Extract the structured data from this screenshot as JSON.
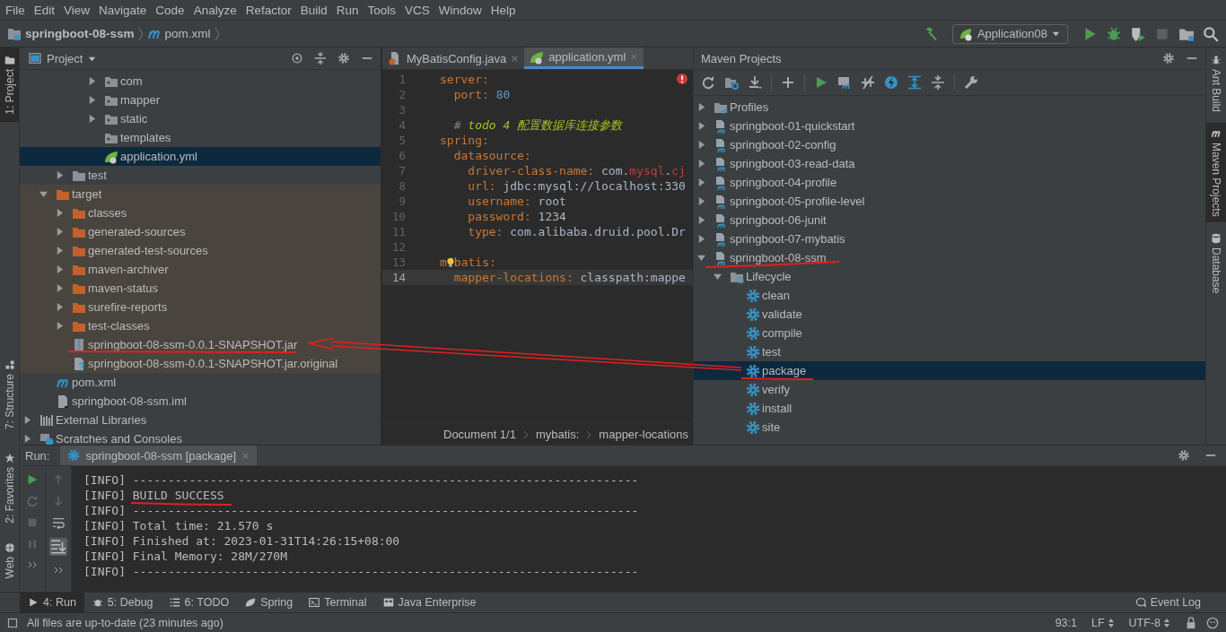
{
  "menu": [
    "File",
    "Edit",
    "View",
    "Navigate",
    "Code",
    "Analyze",
    "Refactor",
    "Build",
    "Run",
    "Tools",
    "VCS",
    "Window",
    "Help"
  ],
  "breadcrumb": [
    {
      "label": "springboot-08-ssm",
      "kind": "project"
    },
    {
      "label": "pom.xml",
      "kind": "maven"
    }
  ],
  "run_config": "Application08",
  "left_tool_tabs": [
    {
      "label": "1: Project",
      "selected": true,
      "kind": "folder"
    },
    {
      "label": "7: Structure",
      "selected": false,
      "kind": "structure"
    }
  ],
  "project_panel": {
    "title": "Project",
    "tree": [
      {
        "children": [
          {
            "children": [
              {
                "children": [
                  {
                    "children": [
                      {
                        "label": "com",
                        "kind": "package-folder",
                        "expanded": false,
                        "selected": false
                      },
                      {
                        "label": "mapper",
                        "kind": "package-folder",
                        "expanded": false,
                        "selected": false
                      },
                      {
                        "label": "static",
                        "kind": "package-folder",
                        "expanded": false,
                        "selected": false
                      },
                      {
                        "label": "templates",
                        "kind": "package-folder",
                        "selected": false
                      },
                      {
                        "label": "application.yml",
                        "kind": "yml",
                        "selected": true
                      }
                    ]
                  }
                ]
              },
              {
                "label": "test",
                "kind": "folder",
                "expanded": false,
                "selected": false
              }
            ]
          },
          {
            "label": "target",
            "kind": "excluded-folder",
            "expanded": true,
            "excluded": true,
            "selected": false,
            "children": [
              {
                "label": "classes",
                "kind": "excluded-folder",
                "expanded": false,
                "selected": false
              },
              {
                "label": "generated-sources",
                "kind": "excluded-folder",
                "expanded": false,
                "selected": false
              },
              {
                "label": "generated-test-sources",
                "kind": "excluded-folder",
                "expanded": false,
                "selected": false
              },
              {
                "label": "maven-archiver",
                "kind": "excluded-folder",
                "expanded": false,
                "selected": false
              },
              {
                "label": "maven-status",
                "kind": "excluded-folder",
                "expanded": false,
                "selected": false
              },
              {
                "label": "surefire-reports",
                "kind": "excluded-folder",
                "expanded": false,
                "selected": false
              },
              {
                "label": "test-classes",
                "kind": "excluded-folder",
                "expanded": false,
                "selected": false
              },
              {
                "label": "springboot-08-ssm-0.0.1-SNAPSHOT.jar",
                "kind": "jar",
                "selected": false
              },
              {
                "label": "springboot-08-ssm-0.0.1-SNAPSHOT.jar.original",
                "kind": "unknown-file",
                "selected": false
              }
            ]
          },
          {
            "label": "pom.xml",
            "kind": "maven",
            "selected": false
          },
          {
            "label": "springboot-08-ssm.iml",
            "kind": "iml",
            "selected": false
          }
        ]
      },
      {
        "label": "External Libraries",
        "kind": "libraries",
        "expanded": false,
        "selected": false
      },
      {
        "label": "Scratches and Consoles",
        "kind": "scratches",
        "expanded": false,
        "selected": false
      }
    ]
  },
  "editor": {
    "tabs": [
      {
        "label": "MyBatisConfig.java",
        "kind": "java",
        "selected": false
      },
      {
        "label": "application.yml",
        "kind": "yml",
        "selected": true
      }
    ],
    "lines": [
      {
        "number": "1",
        "current": false,
        "tokens": [
          {
            "text": "server:",
            "kind": "key"
          }
        ]
      },
      {
        "number": "2",
        "current": false,
        "tokens": [
          {
            "text": "  port: ",
            "kind": "key"
          },
          {
            "text": "80",
            "kind": "number"
          }
        ]
      },
      {
        "number": "3",
        "current": false
      },
      {
        "number": "4",
        "current": false,
        "tokens": [
          {
            "text": "  # ",
            "kind": "comment"
          },
          {
            "text": "todo 4 配置数据库连接参数",
            "kind": "todo"
          }
        ]
      },
      {
        "number": "5",
        "current": false,
        "tokens": [
          {
            "text": "spring:",
            "kind": "key"
          }
        ]
      },
      {
        "number": "6",
        "current": false,
        "tokens": [
          {
            "text": "  datasource:",
            "kind": "key"
          }
        ]
      },
      {
        "number": "7",
        "current": false,
        "tokens": [
          {
            "text": "    driver-class-name: ",
            "kind": "key"
          },
          {
            "text": "com.",
            "kind": "scalar"
          },
          {
            "text": "mysql",
            "kind": "error"
          },
          {
            "text": ".",
            "kind": "scalar"
          },
          {
            "text": "cj",
            "kind": "error"
          }
        ]
      },
      {
        "number": "8",
        "current": false,
        "tokens": [
          {
            "text": "    url: ",
            "kind": "key"
          },
          {
            "text": "jdbc:mysql://localhost:330",
            "kind": "scalar"
          }
        ]
      },
      {
        "number": "9",
        "current": false,
        "tokens": [
          {
            "text": "    username: ",
            "kind": "key"
          },
          {
            "text": "root",
            "kind": "scalar"
          }
        ]
      },
      {
        "number": "10",
        "current": false,
        "tokens": [
          {
            "text": "    password: ",
            "kind": "key"
          },
          {
            "text": "1234",
            "kind": "scalar"
          }
        ]
      },
      {
        "number": "11",
        "current": false,
        "tokens": [
          {
            "text": "    type: ",
            "kind": "key"
          },
          {
            "text": "com.alibaba.druid.pool.Dr",
            "kind": "scalar"
          }
        ]
      },
      {
        "number": "12",
        "current": false
      },
      {
        "number": "13",
        "current": false,
        "tokens": [
          {
            "text": "m",
            "kind": "key"
          },
          {
            "kind": "bulb"
          },
          {
            "text": "batis:",
            "kind": "key"
          }
        ]
      },
      {
        "number": "14",
        "current": true,
        "tokens": [
          {
            "text": "  mapper-locations: ",
            "kind": "key"
          },
          {
            "text": "classpath:mappe",
            "kind": "scalar"
          }
        ]
      }
    ],
    "breadcrumb": [
      "Document 1/1",
      "mybatis:",
      "mapper-locations"
    ]
  },
  "maven_panel": {
    "title": "Maven Projects",
    "tree": [
      {
        "label": "Profiles",
        "kind": "profiles",
        "expanded": false,
        "selected": false
      },
      {
        "label": "springboot-01-quickstart",
        "kind": "module",
        "expanded": false,
        "selected": false
      },
      {
        "label": "springboot-02-config",
        "kind": "module",
        "expanded": false,
        "selected": false
      },
      {
        "label": "springboot-03-read-data",
        "kind": "module",
        "expanded": false,
        "selected": false
      },
      {
        "label": "springboot-04-profile",
        "kind": "module",
        "expanded": false,
        "selected": false
      },
      {
        "label": "springboot-05-profile-level",
        "kind": "module",
        "expanded": false,
        "selected": false
      },
      {
        "label": "springboot-06-junit",
        "kind": "module",
        "expanded": false,
        "selected": false
      },
      {
        "label": "springboot-07-mybatis",
        "kind": "module",
        "expanded": false,
        "selected": false
      },
      {
        "label": "springboot-08-ssm",
        "kind": "module",
        "expanded": true,
        "selected": false,
        "children": [
          {
            "label": "Lifecycle",
            "kind": "lifecycle",
            "expanded": true,
            "selected": false,
            "children": [
              {
                "label": "clean",
                "kind": "phase",
                "selected": false
              },
              {
                "label": "validate",
                "kind": "phase",
                "selected": false
              },
              {
                "label": "compile",
                "kind": "phase",
                "selected": false
              },
              {
                "label": "test",
                "kind": "phase",
                "selected": false
              },
              {
                "label": "package",
                "kind": "phase",
                "selected": true
              },
              {
                "label": "verify",
                "kind": "phase",
                "selected": false
              },
              {
                "label": "install",
                "kind": "phase",
                "selected": false
              },
              {
                "label": "site",
                "kind": "phase",
                "selected": false
              }
            ]
          }
        ]
      }
    ]
  },
  "right_tool_tabs": [
    {
      "label": "Ant Build",
      "selected": false,
      "kind": "ant"
    },
    {
      "label": "Maven Projects",
      "selected": true,
      "kind": "maven"
    },
    {
      "label": "Database",
      "selected": false,
      "kind": "database"
    }
  ],
  "run_panel": {
    "label": "Run:",
    "tab": "springboot-08-ssm [package]",
    "lines": [
      "[INFO] ------------------------------------------------------------------------",
      "[INFO] BUILD SUCCESS",
      "[INFO] ------------------------------------------------------------------------",
      "[INFO] Total time: 21.570 s",
      "[INFO] Finished at: 2023-01-31T14:26:15+08:00",
      "[INFO] Final Memory: 28M/270M",
      "[INFO] ------------------------------------------------------------------------"
    ]
  },
  "bottom_side_tabs": [
    {
      "label": "2: Favorites",
      "kind": "star"
    },
    {
      "label": "Web",
      "kind": "globe"
    }
  ],
  "bottom_tool_tabs": [
    {
      "label": "4: Run",
      "kind": "run",
      "selected": true
    },
    {
      "label": "5: Debug",
      "kind": "debug",
      "selected": false
    },
    {
      "label": "6: TODO",
      "kind": "todo",
      "selected": false
    },
    {
      "label": "Spring",
      "kind": "spring",
      "selected": false
    },
    {
      "label": "Terminal",
      "kind": "terminal",
      "selected": false
    },
    {
      "label": "Java Enterprise",
      "kind": "enterprise",
      "selected": false
    }
  ],
  "event_log": "Event Log",
  "status_bar": {
    "message": "All files are up-to-date (23 minutes ago)",
    "position": "93:1",
    "line_separator": "LF",
    "encoding": "UTF-8"
  }
}
